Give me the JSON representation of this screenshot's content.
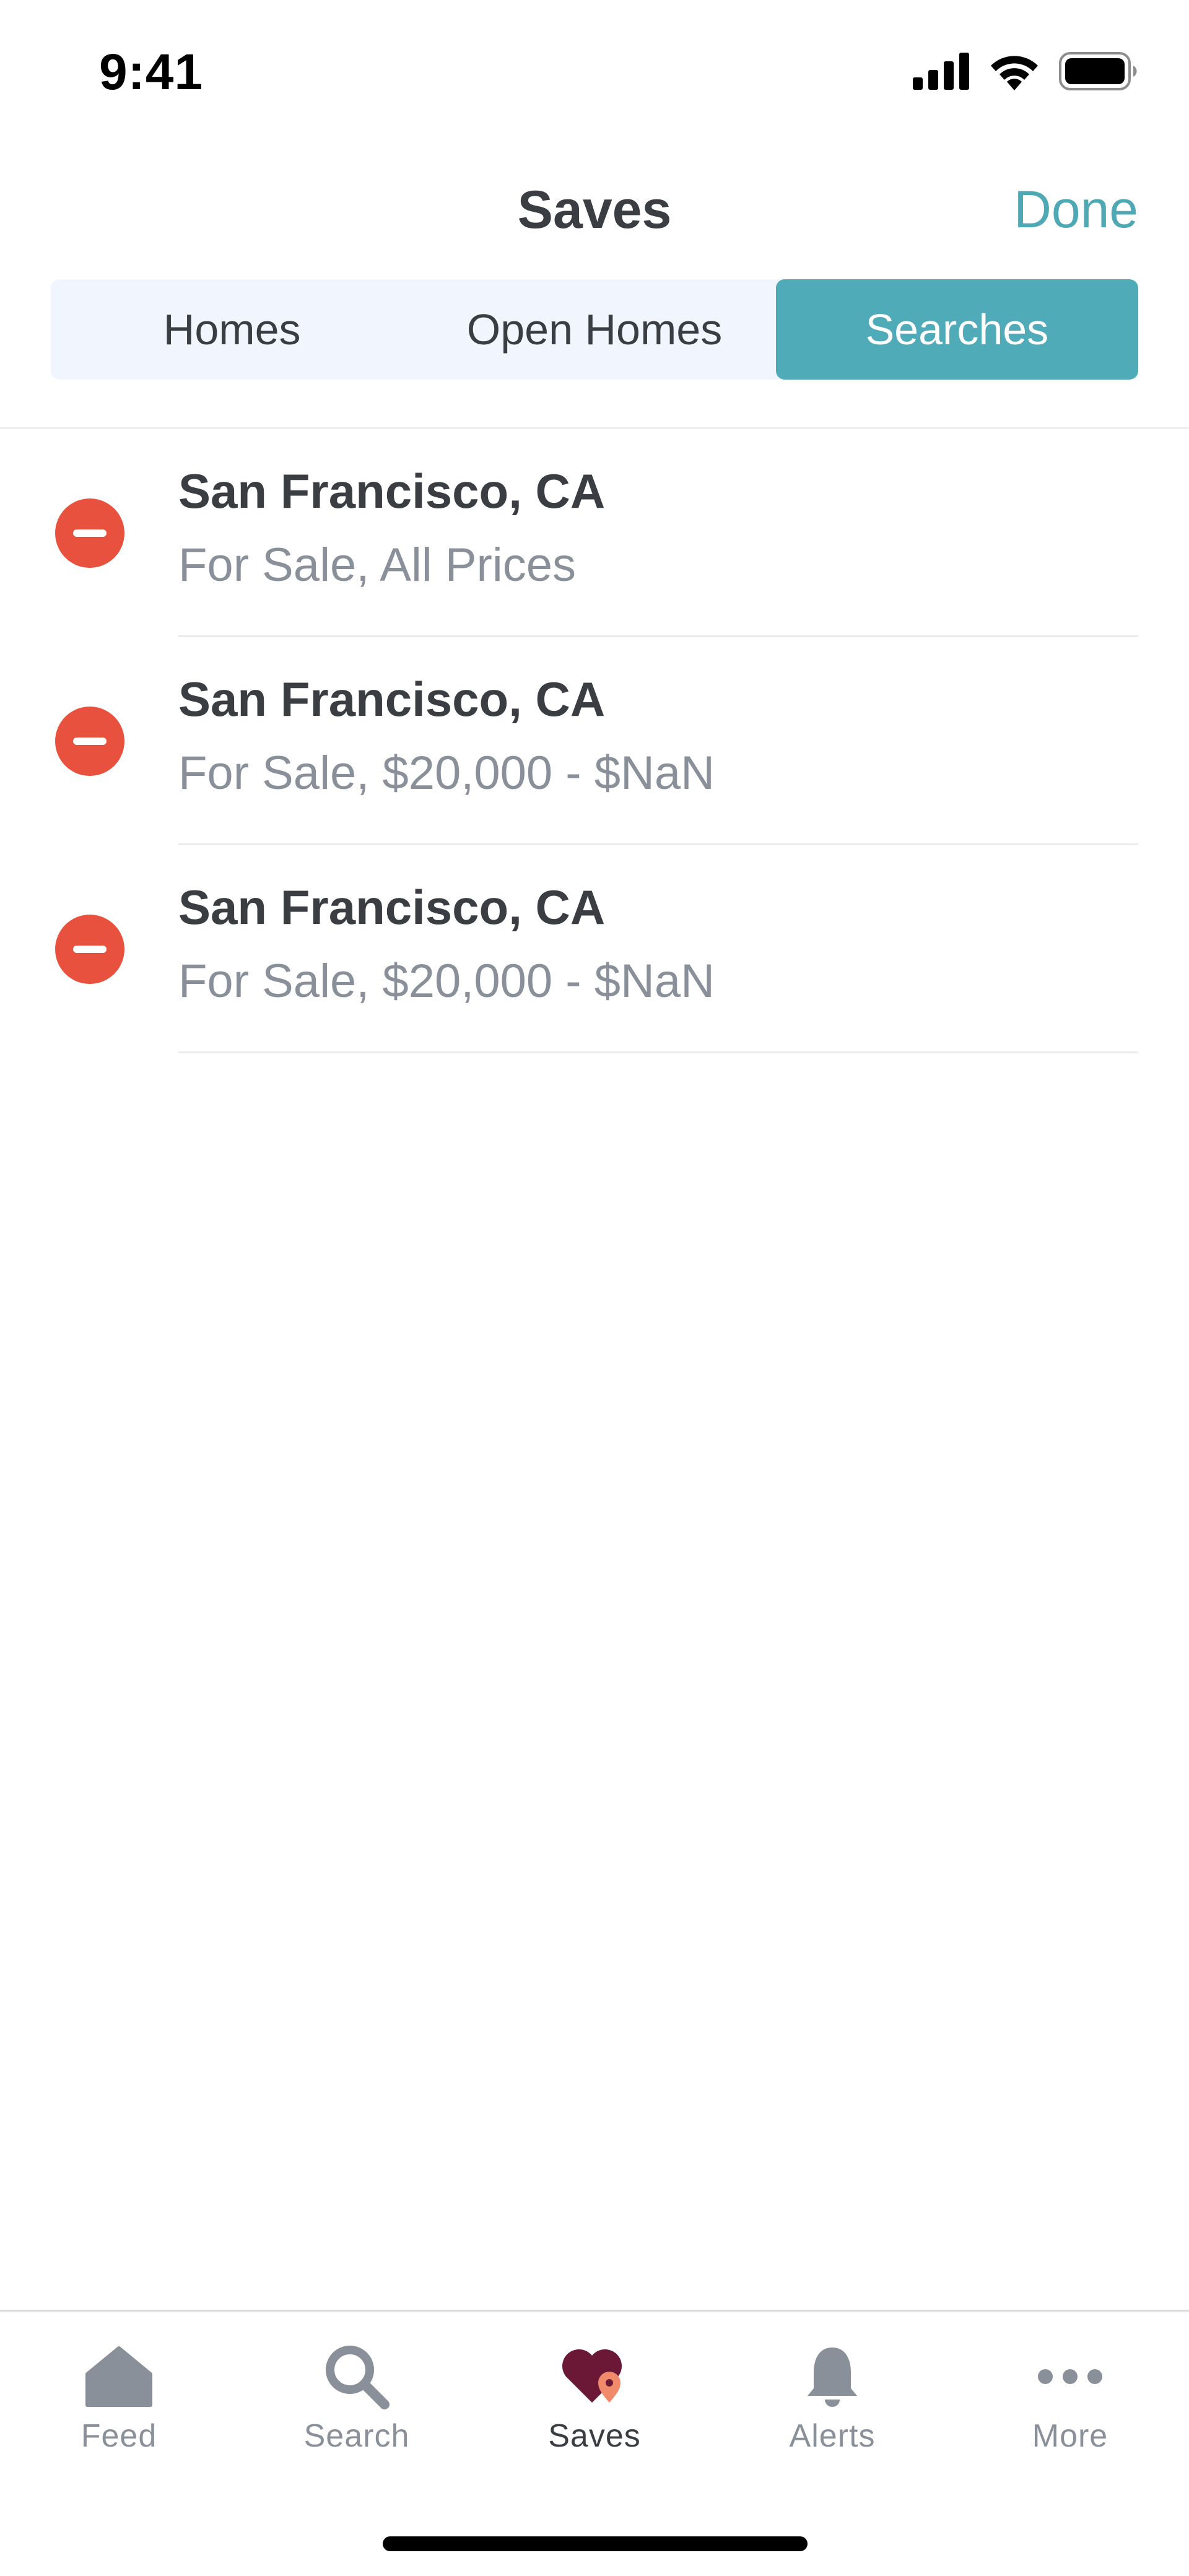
{
  "status_bar": {
    "time": "9:41"
  },
  "nav": {
    "title": "Saves",
    "done_label": "Done"
  },
  "segments": [
    {
      "label": "Homes",
      "active": false
    },
    {
      "label": "Open Homes",
      "active": false
    },
    {
      "label": "Searches",
      "active": true
    }
  ],
  "saved_searches": [
    {
      "title": "San Francisco, CA",
      "subtitle": "For Sale, All Prices"
    },
    {
      "title": "San Francisco, CA",
      "subtitle": "For Sale, $20,000 - $NaN"
    },
    {
      "title": "San Francisco, CA",
      "subtitle": "For Sale, $20,000 - $NaN"
    }
  ],
  "tab_bar": {
    "items": [
      {
        "label": "Feed",
        "icon": "home-icon",
        "active": false
      },
      {
        "label": "Search",
        "icon": "search-icon",
        "active": false
      },
      {
        "label": "Saves",
        "icon": "heart-pin-icon",
        "active": true
      },
      {
        "label": "Alerts",
        "icon": "bell-icon",
        "active": false
      },
      {
        "label": "More",
        "icon": "more-icon",
        "active": false
      }
    ]
  },
  "colors": {
    "accent": "#4fa9b5",
    "segment_active": "#50abb8",
    "segment_bg": "#f1f5fd",
    "delete": "#e8513d",
    "saves_heart": "#6b1836",
    "saves_pin": "#f08a6a"
  }
}
